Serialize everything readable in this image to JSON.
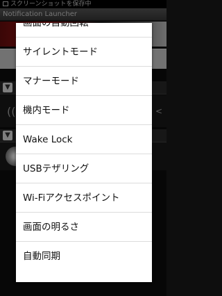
{
  "status_bar": {
    "text": "スクリーンショットを保存中"
  },
  "app": {
    "title": "Notification Launcher"
  },
  "menu": {
    "items": [
      {
        "label": "画面の自動回転"
      },
      {
        "label": "サイレントモード"
      },
      {
        "label": "マナーモード"
      },
      {
        "label": "機内モード"
      },
      {
        "label": "Wake Lock"
      },
      {
        "label": "USBテザリング"
      },
      {
        "label": "Wi-Fiアクセスポイント"
      },
      {
        "label": "画面の明るさ"
      },
      {
        "label": "自動同期"
      }
    ]
  }
}
